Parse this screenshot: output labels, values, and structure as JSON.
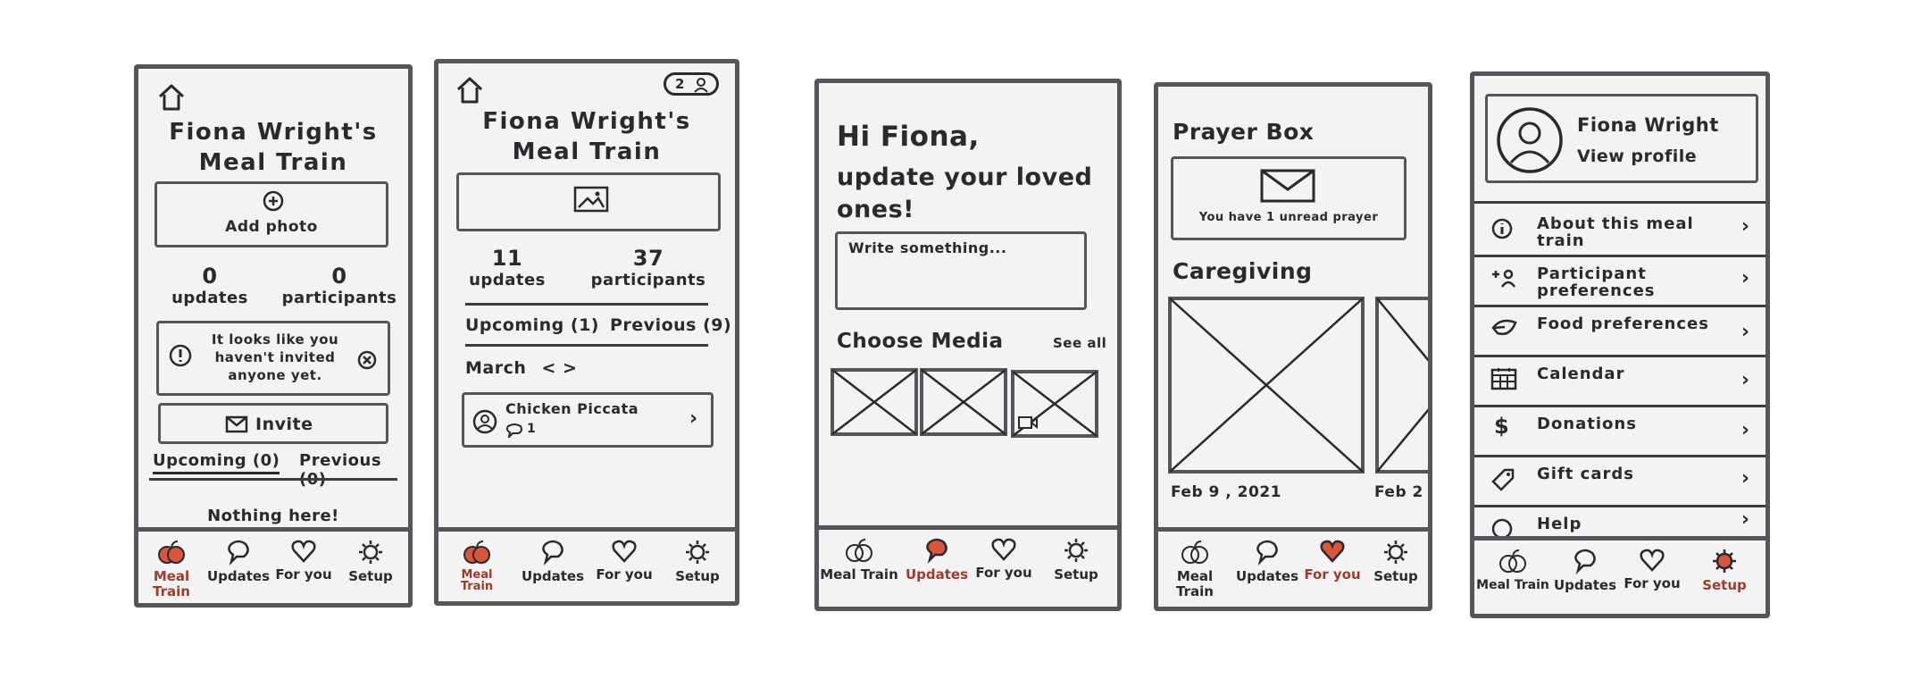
{
  "screens": [
    {
      "title_line1": "Fiona Wright's",
      "title_line2": "Meal Train",
      "add_photo": "Add photo",
      "stats": [
        {
          "num": "0",
          "label": "updates"
        },
        {
          "num": "0",
          "label": "participants"
        }
      ],
      "notice": "It looks like you haven't invited anyone yet.",
      "invite": "Invite",
      "tab_upcoming": "Upcoming (0)",
      "tab_previous": "Previous (0)",
      "empty": "Nothing here!",
      "nav": [
        "Meal Train",
        "Updates",
        "For you",
        "Setup"
      ]
    },
    {
      "participants_badge": "2",
      "title_line1": "Fiona Wright's",
      "title_line2": "Meal Train",
      "stats": [
        {
          "num": "11",
          "label": "updates"
        },
        {
          "num": "37",
          "label": "participants"
        }
      ],
      "tab_upcoming": "Upcoming (1)",
      "tab_previous": "Previous (9)",
      "month": "March",
      "month_arrows": "< >",
      "meal_title": "Chicken Piccata",
      "meal_comments": "1",
      "nav": [
        "Meal Train",
        "Updates",
        "For you",
        "Setup"
      ]
    },
    {
      "greeting": "Hi Fiona,",
      "subtitle_line1": "update your loved",
      "subtitle_line2": "ones!",
      "write_placeholder": "Write something...",
      "choose_media": "Choose Media",
      "see_all": "See all",
      "nav": [
        "Meal Train",
        "Updates",
        "For you",
        "Setup"
      ]
    },
    {
      "prayer_box": "Prayer Box",
      "unread": "You have 1 unread prayer",
      "caregiving": "Caregiving",
      "date1": "Feb 9 , 2021",
      "date2": "Feb 2",
      "nav": [
        "Meal Train",
        "Updates",
        "For you",
        "Setup"
      ]
    },
    {
      "profile_name": "Fiona Wright",
      "view_profile": "View profile",
      "menu": [
        {
          "label": "About this meal train",
          "icon": "info-icon"
        },
        {
          "label": "Participant preferences",
          "icon": "participant-icon"
        },
        {
          "label": "Food preferences",
          "icon": "leaf-icon"
        },
        {
          "label": "Calendar",
          "icon": "calendar-icon"
        },
        {
          "label": "Donations",
          "icon": "dollar-icon"
        },
        {
          "label": "Gift cards",
          "icon": "tag-icon"
        },
        {
          "label": "Help",
          "icon": "help-icon"
        }
      ],
      "nav": [
        "Meal Train",
        "Updates",
        "For you",
        "Setup"
      ]
    }
  ],
  "colors": {
    "ink": "#2a2a2e",
    "frame": "#55565c",
    "accent": "#d9563a",
    "paper": "#f3f3f3"
  }
}
